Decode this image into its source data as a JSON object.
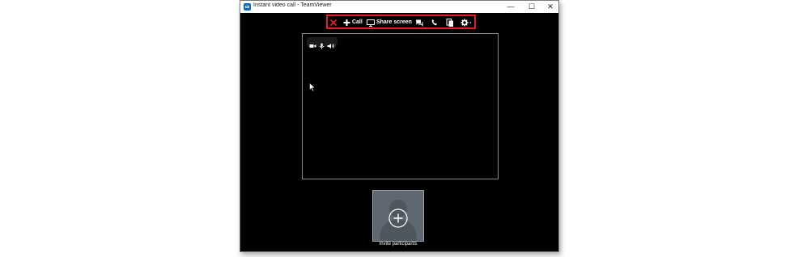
{
  "window": {
    "title": "Instant video call - TeamViewer",
    "controls": {
      "minimize": "—",
      "maximize": "☐",
      "close": "✕"
    }
  },
  "toolbar": {
    "close_icon": "close-icon",
    "call_label": "Call",
    "share_label": "Share screen",
    "icons": [
      "plus-icon",
      "monitor-icon",
      "chat-icon",
      "phone-icon",
      "files-icon",
      "gear-icon"
    ],
    "highlight_color": "#e02020"
  },
  "video": {
    "media_icons": [
      "camera-icon",
      "microphone-icon",
      "speaker-icon"
    ]
  },
  "participants": {
    "invite_label": "Invite participants"
  }
}
